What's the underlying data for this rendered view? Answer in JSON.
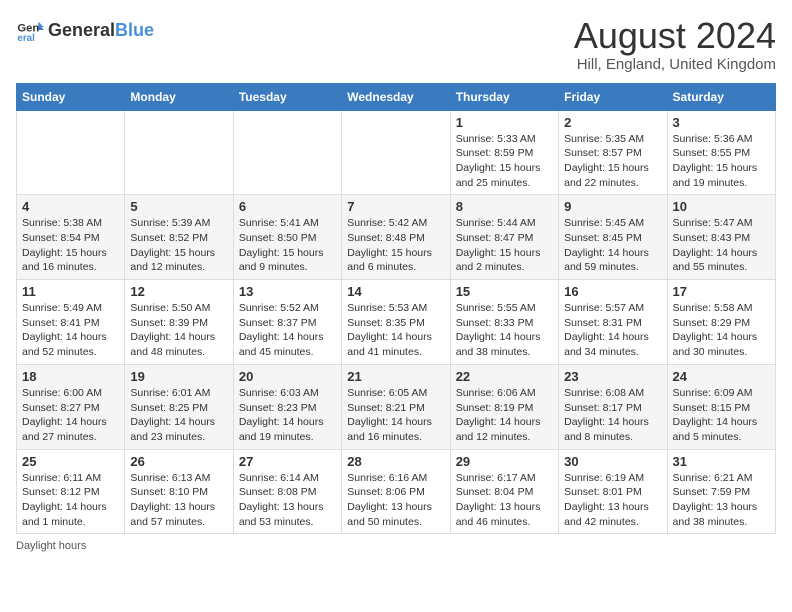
{
  "logo": {
    "general": "General",
    "blue": "Blue"
  },
  "title": "August 2024",
  "subtitle": "Hill, England, United Kingdom",
  "days_header": [
    "Sunday",
    "Monday",
    "Tuesday",
    "Wednesday",
    "Thursday",
    "Friday",
    "Saturday"
  ],
  "weeks": [
    [
      {
        "day": "",
        "info": ""
      },
      {
        "day": "",
        "info": ""
      },
      {
        "day": "",
        "info": ""
      },
      {
        "day": "",
        "info": ""
      },
      {
        "day": "1",
        "info": "Sunrise: 5:33 AM\nSunset: 8:59 PM\nDaylight: 15 hours and 25 minutes."
      },
      {
        "day": "2",
        "info": "Sunrise: 5:35 AM\nSunset: 8:57 PM\nDaylight: 15 hours and 22 minutes."
      },
      {
        "day": "3",
        "info": "Sunrise: 5:36 AM\nSunset: 8:55 PM\nDaylight: 15 hours and 19 minutes."
      }
    ],
    [
      {
        "day": "4",
        "info": "Sunrise: 5:38 AM\nSunset: 8:54 PM\nDaylight: 15 hours and 16 minutes."
      },
      {
        "day": "5",
        "info": "Sunrise: 5:39 AM\nSunset: 8:52 PM\nDaylight: 15 hours and 12 minutes."
      },
      {
        "day": "6",
        "info": "Sunrise: 5:41 AM\nSunset: 8:50 PM\nDaylight: 15 hours and 9 minutes."
      },
      {
        "day": "7",
        "info": "Sunrise: 5:42 AM\nSunset: 8:48 PM\nDaylight: 15 hours and 6 minutes."
      },
      {
        "day": "8",
        "info": "Sunrise: 5:44 AM\nSunset: 8:47 PM\nDaylight: 15 hours and 2 minutes."
      },
      {
        "day": "9",
        "info": "Sunrise: 5:45 AM\nSunset: 8:45 PM\nDaylight: 14 hours and 59 minutes."
      },
      {
        "day": "10",
        "info": "Sunrise: 5:47 AM\nSunset: 8:43 PM\nDaylight: 14 hours and 55 minutes."
      }
    ],
    [
      {
        "day": "11",
        "info": "Sunrise: 5:49 AM\nSunset: 8:41 PM\nDaylight: 14 hours and 52 minutes."
      },
      {
        "day": "12",
        "info": "Sunrise: 5:50 AM\nSunset: 8:39 PM\nDaylight: 14 hours and 48 minutes."
      },
      {
        "day": "13",
        "info": "Sunrise: 5:52 AM\nSunset: 8:37 PM\nDaylight: 14 hours and 45 minutes."
      },
      {
        "day": "14",
        "info": "Sunrise: 5:53 AM\nSunset: 8:35 PM\nDaylight: 14 hours and 41 minutes."
      },
      {
        "day": "15",
        "info": "Sunrise: 5:55 AM\nSunset: 8:33 PM\nDaylight: 14 hours and 38 minutes."
      },
      {
        "day": "16",
        "info": "Sunrise: 5:57 AM\nSunset: 8:31 PM\nDaylight: 14 hours and 34 minutes."
      },
      {
        "day": "17",
        "info": "Sunrise: 5:58 AM\nSunset: 8:29 PM\nDaylight: 14 hours and 30 minutes."
      }
    ],
    [
      {
        "day": "18",
        "info": "Sunrise: 6:00 AM\nSunset: 8:27 PM\nDaylight: 14 hours and 27 minutes."
      },
      {
        "day": "19",
        "info": "Sunrise: 6:01 AM\nSunset: 8:25 PM\nDaylight: 14 hours and 23 minutes."
      },
      {
        "day": "20",
        "info": "Sunrise: 6:03 AM\nSunset: 8:23 PM\nDaylight: 14 hours and 19 minutes."
      },
      {
        "day": "21",
        "info": "Sunrise: 6:05 AM\nSunset: 8:21 PM\nDaylight: 14 hours and 16 minutes."
      },
      {
        "day": "22",
        "info": "Sunrise: 6:06 AM\nSunset: 8:19 PM\nDaylight: 14 hours and 12 minutes."
      },
      {
        "day": "23",
        "info": "Sunrise: 6:08 AM\nSunset: 8:17 PM\nDaylight: 14 hours and 8 minutes."
      },
      {
        "day": "24",
        "info": "Sunrise: 6:09 AM\nSunset: 8:15 PM\nDaylight: 14 hours and 5 minutes."
      }
    ],
    [
      {
        "day": "25",
        "info": "Sunrise: 6:11 AM\nSunset: 8:12 PM\nDaylight: 14 hours and 1 minute."
      },
      {
        "day": "26",
        "info": "Sunrise: 6:13 AM\nSunset: 8:10 PM\nDaylight: 13 hours and 57 minutes."
      },
      {
        "day": "27",
        "info": "Sunrise: 6:14 AM\nSunset: 8:08 PM\nDaylight: 13 hours and 53 minutes."
      },
      {
        "day": "28",
        "info": "Sunrise: 6:16 AM\nSunset: 8:06 PM\nDaylight: 13 hours and 50 minutes."
      },
      {
        "day": "29",
        "info": "Sunrise: 6:17 AM\nSunset: 8:04 PM\nDaylight: 13 hours and 46 minutes."
      },
      {
        "day": "30",
        "info": "Sunrise: 6:19 AM\nSunset: 8:01 PM\nDaylight: 13 hours and 42 minutes."
      },
      {
        "day": "31",
        "info": "Sunrise: 6:21 AM\nSunset: 7:59 PM\nDaylight: 13 hours and 38 minutes."
      }
    ]
  ],
  "footer": "Daylight hours"
}
